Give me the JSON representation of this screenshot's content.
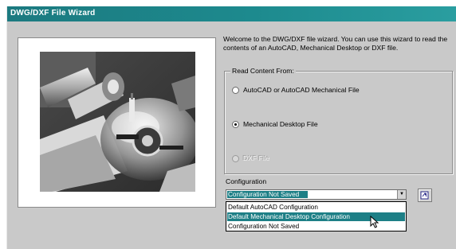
{
  "window": {
    "title": "DWG/DXF File Wizard"
  },
  "intro": {
    "text": "Welcome to the DWG/DXF file wizard. You can use this wizard to read the contents of an AutoCAD, Mechanical Desktop or DXF file."
  },
  "read_content": {
    "label": "Read Content From:",
    "options": [
      {
        "label": "AutoCAD or AutoCAD Mechanical File",
        "checked": false,
        "enabled": true
      },
      {
        "label": "Mechanical Desktop File",
        "checked": true,
        "enabled": true
      },
      {
        "label": "DXF File",
        "checked": false,
        "enabled": false
      }
    ]
  },
  "configuration": {
    "label": "Configuration",
    "selected": "Configuration Not Saved",
    "options": [
      "Default AutoCAD Configuration",
      "Default Mechanical Desktop Configuration",
      "Configuration Not Saved"
    ],
    "highlighted_option_index": 1
  },
  "icons": {
    "dropdown_arrow": "chevron-down-icon",
    "browse": "browse-icon",
    "cursor": "mouse-pointer-icon"
  },
  "colors": {
    "title_bar": "#1d8a8e",
    "selection": "#1d7f86",
    "dialog_bg": "#c9c9c9"
  }
}
